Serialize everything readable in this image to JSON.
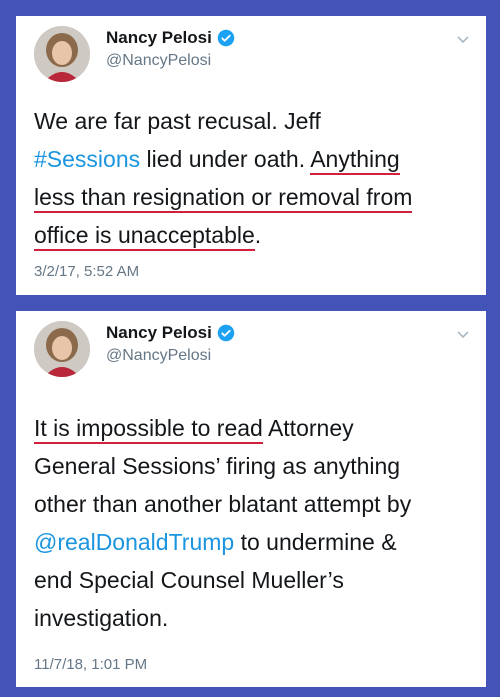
{
  "colors": {
    "border": "#4353b8",
    "link": "#1b95e0",
    "underline": "#d21f3c",
    "verified": "#1da1f2",
    "meta": "#657786"
  },
  "tweets": [
    {
      "name": "Nancy Pelosi",
      "handle": "@NancyPelosi",
      "verified_icon": "verified-badge-icon",
      "menu_icon": "chevron-down-icon",
      "lines": [
        {
          "segments": [
            {
              "text": "We are far past recusal. Jeff"
            }
          ]
        },
        {
          "segments": [
            {
              "text": "#Sessions"
            },
            {
              "text": " lied under oath. "
            },
            {
              "text": "Anything"
            }
          ]
        },
        {
          "segments": [
            {
              "text": "less than resignation or removal from"
            }
          ]
        },
        {
          "segments": [
            {
              "text": "office is unacceptable"
            },
            {
              "text": "."
            }
          ]
        }
      ],
      "date": "3/2/17, 5:52 AM"
    },
    {
      "name": "Nancy Pelosi",
      "handle": "@NancyPelosi",
      "verified_icon": "verified-badge-icon",
      "menu_icon": "chevron-down-icon",
      "lines": [
        {
          "segments": [
            {
              "text": "It is impossible to read"
            },
            {
              "text": " Attorney"
            }
          ]
        },
        {
          "segments": [
            {
              "text": "General Sessions’ firing as anything"
            }
          ]
        },
        {
          "segments": [
            {
              "text": "other than another blatant attempt by"
            }
          ]
        },
        {
          "segments": [
            {
              "text": "@realDonaldTrump"
            },
            {
              "text": " to undermine &"
            }
          ]
        },
        {
          "segments": [
            {
              "text": "end Special Counsel Mueller’s"
            }
          ]
        },
        {
          "segments": [
            {
              "text": "investigation."
            }
          ]
        }
      ],
      "date": "11/7/18, 1:01 PM"
    }
  ]
}
